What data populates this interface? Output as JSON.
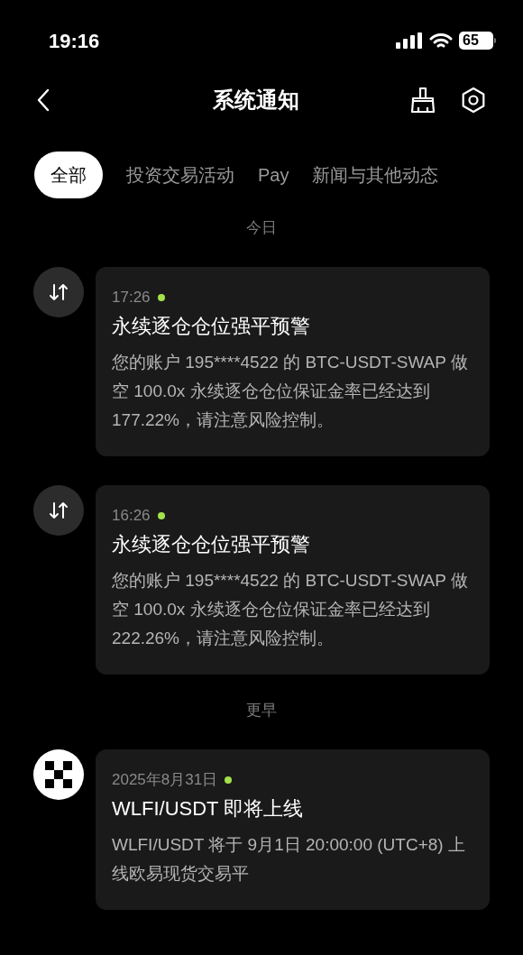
{
  "status_bar": {
    "time": "19:16",
    "battery": "65"
  },
  "header": {
    "title": "系统通知"
  },
  "tabs": [
    {
      "label": "全部",
      "selected": true
    },
    {
      "label": "投资交易活动",
      "selected": false
    },
    {
      "label": "Pay",
      "selected": false
    },
    {
      "label": "新闻与其他动态",
      "selected": false
    }
  ],
  "sections": [
    {
      "heading": "今日",
      "notifications": [
        {
          "kind": "trade",
          "time": "17:26",
          "unread": true,
          "title": "永续逐仓仓位强平预警",
          "body": "您的账户 195****4522 的 BTC-USDT-SWAP 做空 100.0x 永续逐仓仓位保证金率已经达到 177.22%，请注意风险控制。"
        },
        {
          "kind": "trade",
          "time": "16:26",
          "unread": true,
          "title": "永续逐仓仓位强平预警",
          "body": "您的账户 195****4522 的 BTC-USDT-SWAP 做空 100.0x 永续逐仓仓位保证金率已经达到 222.26%，请注意风险控制。"
        }
      ]
    },
    {
      "heading": "更早",
      "notifications": [
        {
          "kind": "logo",
          "time": "2025年8月31日",
          "unread": true,
          "title": "WLFI/USDT 即将上线",
          "body": "WLFI/USDT 将于 9月1日 20:00:00 (UTC+8) 上线欧易现货交易平"
        }
      ]
    }
  ]
}
